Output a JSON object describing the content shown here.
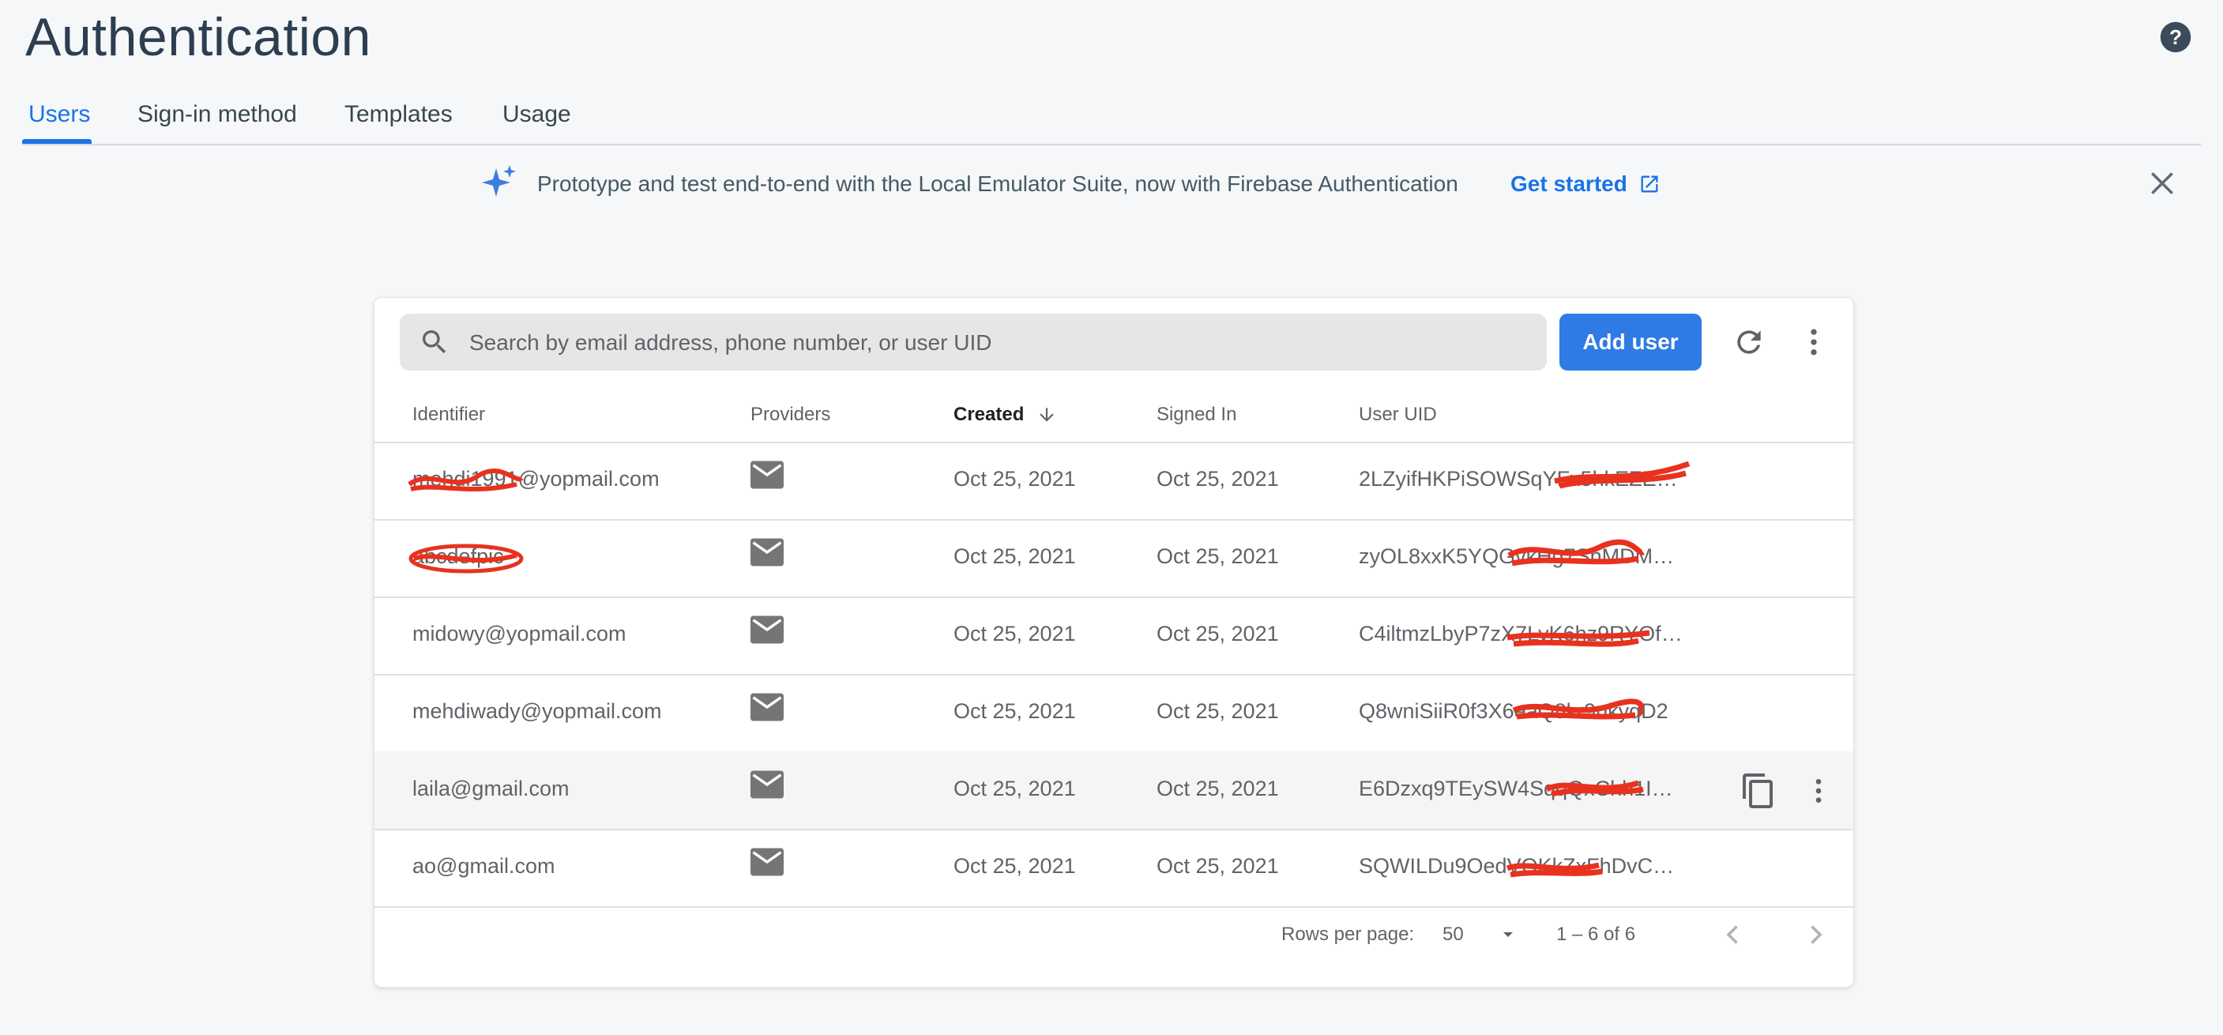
{
  "page": {
    "title": "Authentication"
  },
  "tabs": [
    {
      "label": "Users",
      "active": true
    },
    {
      "label": "Sign-in method"
    },
    {
      "label": "Templates"
    },
    {
      "label": "Usage"
    }
  ],
  "banner": {
    "message": "Prototype and test end-to-end with the Local Emulator Suite, now with Firebase Authentication",
    "cta": "Get started"
  },
  "toolbar": {
    "search_placeholder": "Search by email address, phone number, or user UID",
    "add_user": "Add user"
  },
  "table": {
    "columns": [
      "Identifier",
      "Providers",
      "Created",
      "Signed In",
      "User UID"
    ],
    "sorted_column": "Created",
    "rows": [
      {
        "identifier": "mehdi1991@yopmail.com",
        "provider": "email",
        "created": "Oct 25, 2021",
        "signed_in": "Oct 25, 2021",
        "uid": "2LZyifHKPiSOWSqYFx5hkEZEPYuz1"
      },
      {
        "identifier": "abcdefpic",
        "provider": "email",
        "created": "Oct 25, 2021",
        "signed_in": "Oct 25, 2021",
        "uid": "zyOL8xxK5YQGvkHg7ShMDMnbj…"
      },
      {
        "identifier": "midowy@yopmail.com",
        "provider": "email",
        "created": "Oct 25, 2021",
        "signed_in": "Oct 25, 2021",
        "uid": "C4iltmzLbyP7zX7LyK6hz9RYOfp2"
      },
      {
        "identifier": "mehdiwady@yopmail.com",
        "provider": "email",
        "created": "Oct 25, 2021",
        "signed_in": "Oct 25, 2021",
        "uid": "Q8wniSiiR0f3X6eaQ8kr9nkyqD2"
      },
      {
        "identifier": "laila@gmail.com",
        "provider": "email",
        "created": "Oct 25, 2021",
        "signed_in": "Oct 25, 2021",
        "uid": "E6Dzxq9TEySW4SqqQxChh1IgT…"
      },
      {
        "identifier": "ao@gmail.com",
        "provider": "email",
        "created": "Oct 25, 2021",
        "signed_in": "Oct 25, 2021",
        "uid": "SQWILDu9OedVOKkZxFhDvCqy…"
      }
    ]
  },
  "pagination": {
    "rows_per_page_label": "Rows per page:",
    "rows_per_page": "50",
    "range": "1 – 6 of 6"
  },
  "colors": {
    "accent": "#1a73e8",
    "button": "#2f7be5",
    "redaction": "#e8321e"
  },
  "icons": [
    "help-icon",
    "sparkle-icon",
    "external-link-icon",
    "close-icon",
    "search-icon",
    "refresh-icon",
    "more-vert-icon",
    "mail-icon",
    "copy-icon",
    "sort-arrow-down-icon",
    "dropdown-icon",
    "chevron-left-icon",
    "chevron-right-icon"
  ]
}
